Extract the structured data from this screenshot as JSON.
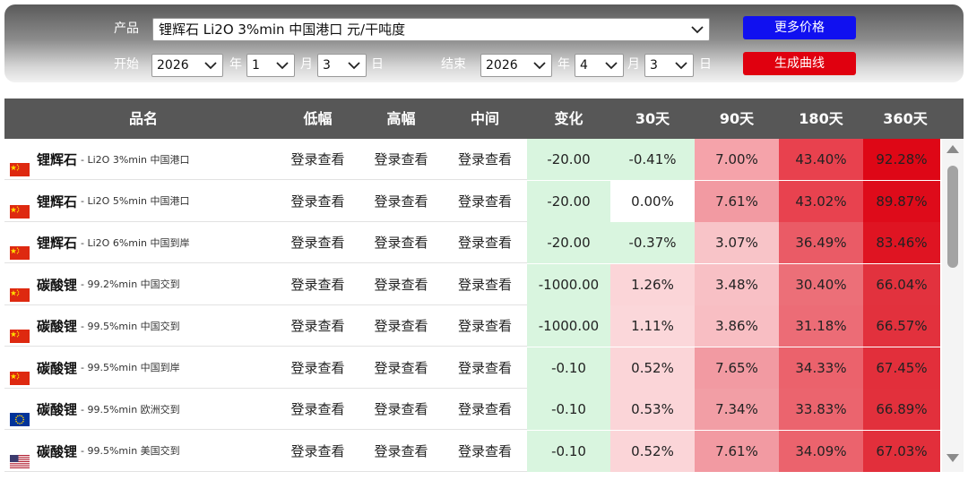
{
  "controls": {
    "product_label": "产品",
    "product_value": "锂辉石 Li2O 3%min 中国港口 元/干吨度",
    "start_label": "开始",
    "end_label": "结束",
    "start": {
      "year": "2026",
      "month": "1",
      "day": "3"
    },
    "end": {
      "year": "2026",
      "month": "4",
      "day": "3"
    },
    "year_unit": "年",
    "month_unit": "月",
    "day_unit": "日",
    "more_prices": "更多价格",
    "generate_curve": "生成曲线"
  },
  "table": {
    "headers": [
      "品名",
      "低幅",
      "高幅",
      "中间",
      "变化",
      "30天",
      "90天",
      "180天",
      "360天"
    ],
    "login_text": "登录查看",
    "rows": [
      {
        "flag": "cn-flag-icon",
        "name": "锂辉石",
        "spec": "- Li2O 3%min 中国港口",
        "change": "-20.00",
        "d30": "-0.41%",
        "d90": "7.00%",
        "d180": "43.40%",
        "d360": "92.28%",
        "c30": "#d9f5df",
        "c90": "#f5a3aa",
        "c180": "#e8414e",
        "c360": "#de0716"
      },
      {
        "flag": "cn-flag-icon",
        "name": "锂辉石",
        "spec": "- Li2O 5%min 中国港口",
        "change": "-20.00",
        "d30": "0.00%",
        "d90": "7.61%",
        "d180": "43.02%",
        "d360": "89.87%",
        "c30": "#ffffff",
        "c90": "#f29aa2",
        "c180": "#e8424f",
        "c360": "#de0b1a"
      },
      {
        "flag": "cn-flag-icon",
        "name": "锂辉石",
        "spec": "- Li2O 6%min 中国到岸",
        "change": "-20.00",
        "d30": "-0.37%",
        "d90": "3.07%",
        "d180": "36.49%",
        "d360": "83.46%",
        "c30": "#d9f5df",
        "c90": "#f8c4c8",
        "c180": "#ea5b66",
        "c360": "#df1422"
      },
      {
        "flag": "cn-flag-icon",
        "name": "碳酸锂",
        "spec": "- 99.2%min 中国交到",
        "change": "-1000.00",
        "d30": "1.26%",
        "d90": "3.48%",
        "d180": "30.40%",
        "d360": "66.04%",
        "c30": "#fbd5d8",
        "c90": "#f8c0c5",
        "c180": "#ec6f78",
        "c360": "#e2323e"
      },
      {
        "flag": "cn-flag-icon",
        "name": "碳酸锂",
        "spec": "- 99.5%min 中国交到",
        "change": "-1000.00",
        "d30": "1.11%",
        "d90": "3.86%",
        "d180": "31.18%",
        "d360": "66.57%",
        "c30": "#fbd7da",
        "c90": "#f8bec3",
        "c180": "#ec6c76",
        "c360": "#e2313d"
      },
      {
        "flag": "cn-flag-icon",
        "name": "碳酸锂",
        "spec": "- 99.5%min 中国到岸",
        "change": "-0.10",
        "d30": "0.52%",
        "d90": "7.65%",
        "d180": "34.33%",
        "d360": "67.45%",
        "c30": "#fbd5d8",
        "c90": "#f29aa2",
        "c180": "#eb626c",
        "c360": "#e22f3b"
      },
      {
        "flag": "eu-flag-icon",
        "name": "碳酸锂",
        "spec": "- 99.5%min 欧洲交到",
        "change": "-0.10",
        "d30": "0.53%",
        "d90": "7.34%",
        "d180": "33.83%",
        "d360": "66.89%",
        "c30": "#fbd5d8",
        "c90": "#f29ea5",
        "c180": "#eb646e",
        "c360": "#e2303c"
      },
      {
        "flag": "us-flag-icon",
        "name": "碳酸锂",
        "spec": "- 99.5%min 美国交到",
        "change": "-0.10",
        "d30": "0.52%",
        "d90": "7.61%",
        "d180": "34.09%",
        "d360": "67.03%",
        "c30": "#fbd5d8",
        "c90": "#f29aa2",
        "c180": "#eb636d",
        "c360": "#e22f3b"
      }
    ],
    "change_bg": "#d9f5df"
  }
}
